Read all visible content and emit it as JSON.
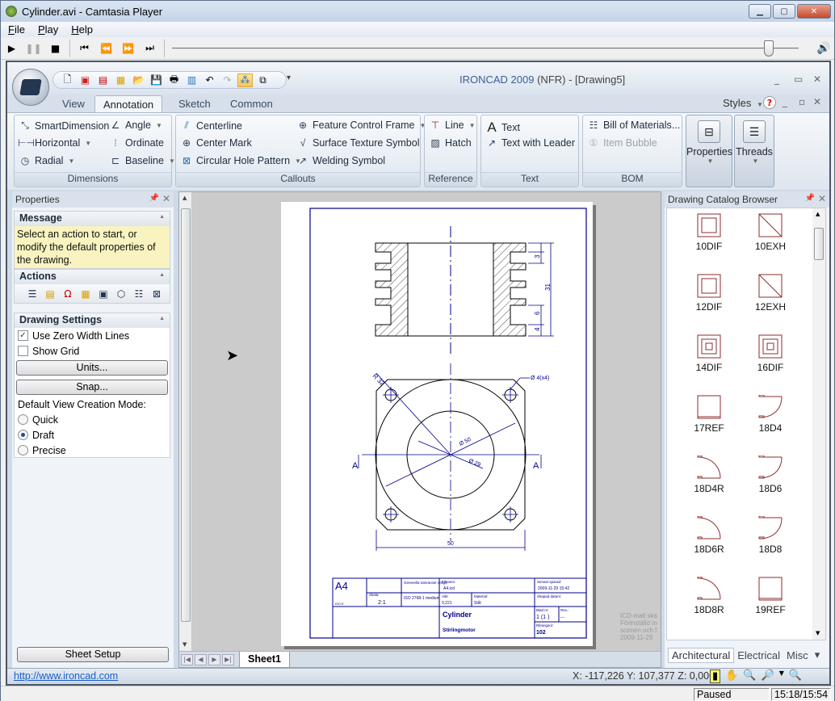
{
  "player": {
    "title": "Cylinder.avi - Camtasia Player",
    "menu": [
      {
        "label": "File",
        "key": "F"
      },
      {
        "label": "Play",
        "key": "P"
      },
      {
        "label": "Help",
        "key": "H"
      }
    ],
    "controls": [
      "play",
      "pause",
      "stop",
      "skip-to-start",
      "rewind",
      "fast-forward",
      "skip-to-end"
    ],
    "position_fraction": 0.96,
    "status": "Paused",
    "time": "15:18/15:54"
  },
  "app": {
    "title_brand": "IRONCAD 2009",
    "title_rest": " (NFR) - [Drawing5]",
    "tabs": [
      "View",
      "Annotation",
      "Sketch",
      "Common"
    ],
    "active_tab": "Annotation",
    "styles_label": "Styles",
    "ribbon": {
      "dimensions": {
        "label": "Dimensions",
        "items": [
          "SmartDimension",
          "Angle",
          "Horizontal",
          "Ordinate",
          "Radial",
          "Baseline"
        ]
      },
      "callouts": {
        "label": "Callouts",
        "items": [
          "Centerline",
          "Feature Control Frame",
          "Center Mark",
          "Surface Texture Symbol",
          "Circular Hole Pattern",
          "Welding Symbol"
        ]
      },
      "reference": {
        "label": "Reference",
        "items": [
          "Line",
          "Hatch"
        ]
      },
      "text": {
        "label": "Text",
        "items": [
          "Text",
          "Text with Leader"
        ]
      },
      "bom": {
        "label": "BOM",
        "items": [
          "Bill of Materials...",
          "Item Bubble"
        ]
      },
      "properties_label": "Properties",
      "threads_label": "Threads"
    }
  },
  "properties_panel": {
    "title": "Properties",
    "message_header": "Message",
    "message": "Select an action to start, or modify the default properties of the drawing.",
    "actions_header": "Actions",
    "settings_header": "Drawing Settings",
    "use_zero_width": {
      "label": "Use Zero Width Lines",
      "checked": true
    },
    "show_grid": {
      "label": "Show Grid",
      "checked": false
    },
    "units_button": "Units...",
    "snap_button": "Snap...",
    "view_mode_label": "Default View Creation Mode:",
    "modes": [
      {
        "label": "Quick",
        "selected": false
      },
      {
        "label": "Draft",
        "selected": true
      },
      {
        "label": "Precise",
        "selected": false
      }
    ],
    "sheet_setup": "Sheet Setup"
  },
  "drawing": {
    "sheet_tab": "Sheet1",
    "dims": {
      "d3": "3",
      "d31": "31",
      "d6": "6",
      "d4": "4",
      "r32": "R 32",
      "hole": "Ø 4(x4)",
      "dia50": "Ø 50",
      "dia29": "Ø 29",
      "w50": "50",
      "section": "A"
    },
    "titleblock": {
      "size": "A4",
      "iso": "ISO E",
      "scale_label": "Skala:",
      "scale": "2:1",
      "tolerance_label": "Generella toleranser enligt:",
      "tolerance": "ISO 2768-1 medium",
      "filename_label": "Filnamn:",
      "filename": "A4.icd",
      "saved_label": "Senast sparad:",
      "saved": "2009-11-29 15:42",
      "weight_label": "Vikt:",
      "weight": "0,221",
      "material_label": "Material:",
      "material": "Stål",
      "created_label": "Skapad datum:",
      "title": "Cylinder",
      "subtitle": "Stirlingmotor",
      "sheet_label": "Blad nr:",
      "sheet": "1  (1 )",
      "rev_label": "Rev.:",
      "rev": "---",
      "drawing_no_label": "Ritningsnr:",
      "drawing_no": "102"
    },
    "side_note": [
      "ICD-mall ska",
      "Förinställd m",
      "scenen och f",
      "2009-11-29"
    ]
  },
  "catalog": {
    "title": "Drawing Catalog Browser",
    "items": [
      "10DIF",
      "10EXH",
      "12DIF",
      "12EXH",
      "14DIF",
      "16DIF",
      "17REF",
      "18D4",
      "18D4R",
      "18D6",
      "18D6R",
      "18D8",
      "18D8R",
      "19REF"
    ],
    "tabs": [
      "Architectural",
      "Electrical",
      "Misc"
    ],
    "active_tab": "Architectural"
  },
  "statusbar": {
    "link": "http://www.ironcad.com",
    "coords": "X: -117,226 Y: 107,377 Z: 0,000"
  }
}
